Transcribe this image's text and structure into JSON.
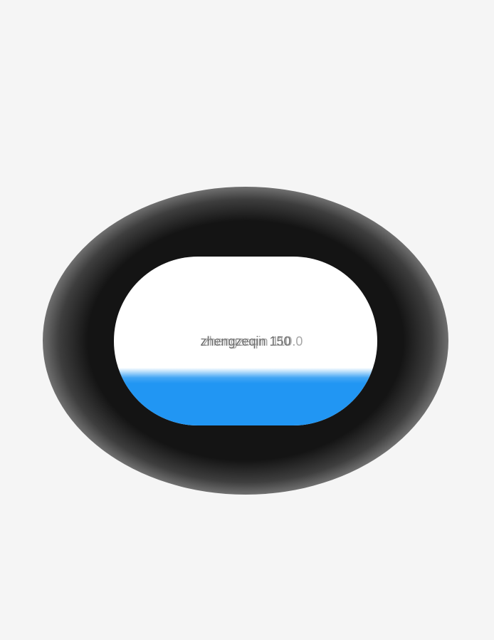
{
  "ticker": {
    "label_primary": "zhengzeqin 150",
    "label_overlap": "zhengzeqin 110.0",
    "progress_fraction": 0.34
  },
  "colors": {
    "background": "#f5f5f5",
    "halo": "#141414",
    "card": "#ffffff",
    "accent": "#2196f3",
    "text": "#6a6a6a"
  }
}
